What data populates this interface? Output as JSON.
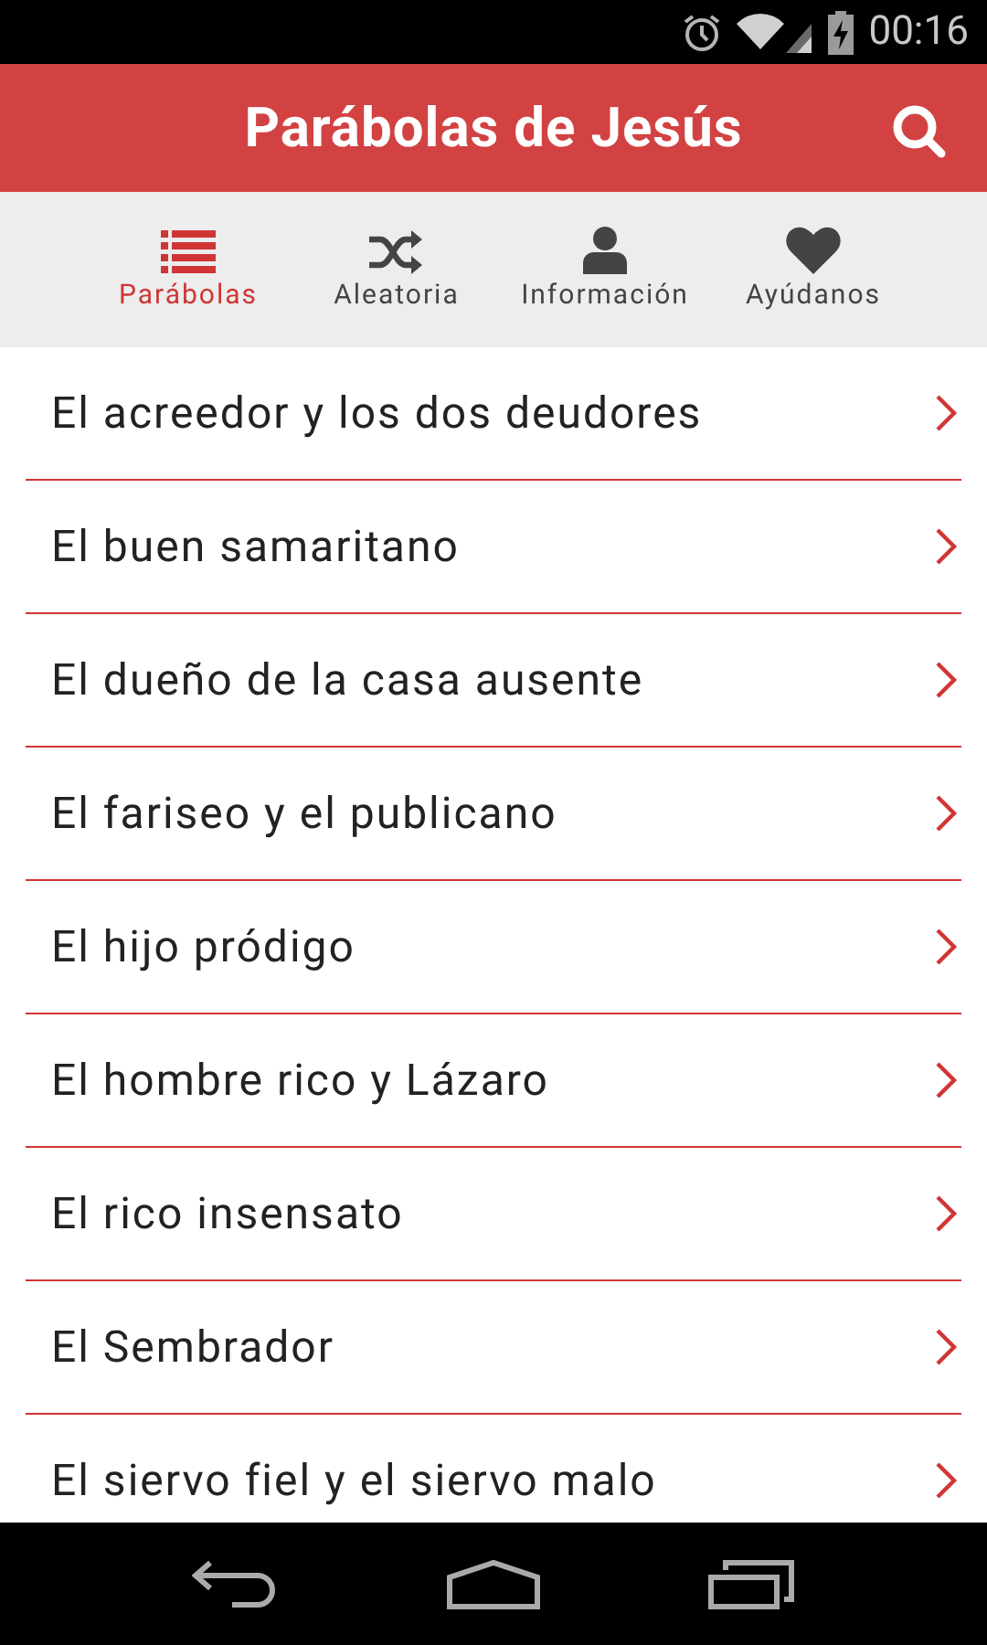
{
  "status_bar": {
    "time": "00:16"
  },
  "app_bar": {
    "title": "Parábolas de Jesús"
  },
  "tabs": [
    {
      "label": "Parábolas",
      "kind": "list",
      "selected": true
    },
    {
      "label": "Aleatoria",
      "kind": "shuffle",
      "selected": false
    },
    {
      "label": "Información",
      "kind": "user",
      "selected": false
    },
    {
      "label": "Ayúdanos",
      "kind": "heart",
      "selected": false
    }
  ],
  "parables": [
    {
      "title": "El acreedor y los dos deudores"
    },
    {
      "title": "El buen samaritano"
    },
    {
      "title": "El dueño de la casa ausente"
    },
    {
      "title": "El fariseo y el publicano"
    },
    {
      "title": "El hijo pródigo"
    },
    {
      "title": "El hombre rico y Lázaro"
    },
    {
      "title": "El rico insensato"
    },
    {
      "title": "El Sembrador"
    },
    {
      "title": "El siervo fiel y el siervo malo"
    }
  ]
}
